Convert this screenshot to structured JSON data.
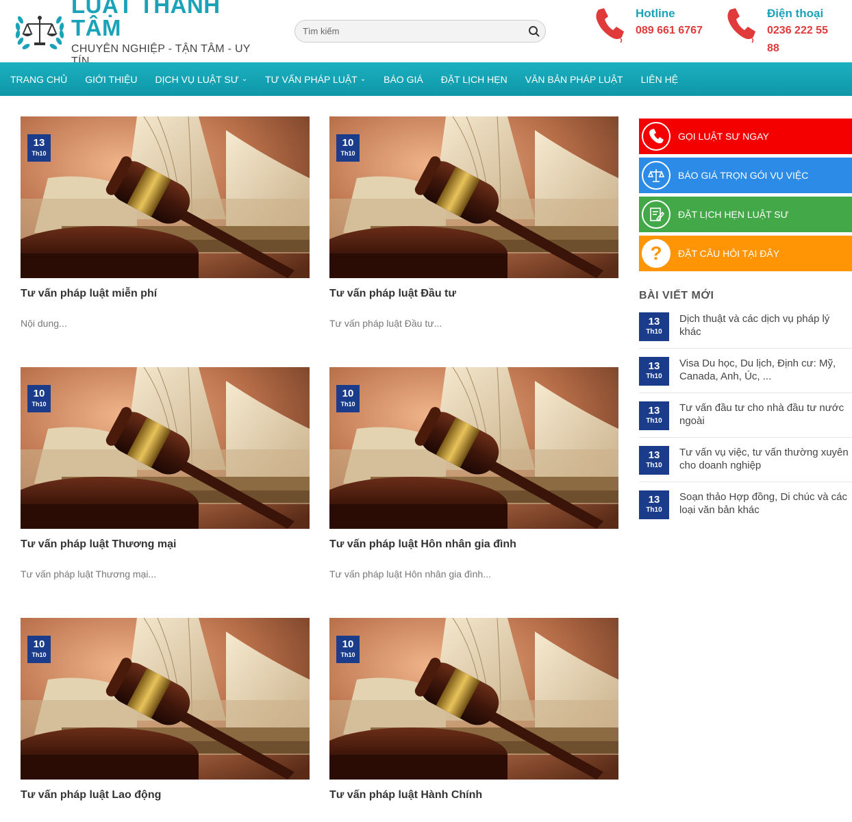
{
  "logo": {
    "title": "LUẬT THANH TÂM",
    "subtitle": "CHUYÊN NGHIỆP - TẬN TÂM - UY TÍN"
  },
  "search": {
    "placeholder": "Tìm kiếm"
  },
  "contacts": [
    {
      "label": "Hotline",
      "value": "089 661 6767"
    },
    {
      "label": "Điện thoại",
      "value_line1": "0236 222 55",
      "value_line2": "88"
    }
  ],
  "nav": [
    {
      "label": "TRANG CHỦ"
    },
    {
      "label": "GIỚI THIỆU"
    },
    {
      "label": "DỊCH VỤ LUẬT SƯ",
      "dropdown": true
    },
    {
      "label": "TƯ VẤN PHÁP LUẬT",
      "dropdown": true
    },
    {
      "label": "BÁO GIÁ"
    },
    {
      "label": "ĐẶT LỊCH HẸN"
    },
    {
      "label": "VĂN BẢN PHÁP LUẬT"
    },
    {
      "label": "LIÊN HỆ"
    }
  ],
  "posts": [
    {
      "day": "13",
      "month": "Th10",
      "title": "Tư vấn pháp luật miễn phí",
      "excerpt": "Nội dung..."
    },
    {
      "day": "10",
      "month": "Th10",
      "title": "Tư vấn pháp luật Đầu tư",
      "excerpt": "Tư vấn pháp luật Đầu tư..."
    },
    {
      "day": "10",
      "month": "Th10",
      "title": "Tư vấn pháp luật Thương mại",
      "excerpt": "Tư vấn pháp luật Thương mại..."
    },
    {
      "day": "10",
      "month": "Th10",
      "title": "Tư vấn pháp luật Hôn nhân gia đình",
      "excerpt": "Tư vấn pháp luật Hôn nhân gia đình..."
    },
    {
      "day": "10",
      "month": "Th10",
      "title": "Tư vấn pháp luật Lao động",
      "excerpt": ""
    },
    {
      "day": "10",
      "month": "Th10",
      "title": "Tư vấn pháp luật Hành Chính",
      "excerpt": ""
    }
  ],
  "sidebar": {
    "ctas": [
      {
        "label": "GỌI LUẬT SƯ NGAY",
        "color": "#f40000",
        "icon": "phone-icon"
      },
      {
        "label": "BÁO GIÁ TRỌN GÓI VỤ VIỆC",
        "color": "#2c8be6",
        "icon": "scales-icon"
      },
      {
        "label": "ĐẶT LỊCH HẸN LUẬT SƯ",
        "color": "#43a948",
        "icon": "edit-document-icon"
      },
      {
        "label": "ĐẶT CÂU HỎI TẠI ĐÂY",
        "color": "#ff9405",
        "icon": "question-icon"
      }
    ],
    "recent_heading": "BÀI VIẾT MỚI",
    "recent": [
      {
        "day": "13",
        "month": "Th10",
        "title": "Dịch thuật và các dịch vụ pháp lý khác"
      },
      {
        "day": "13",
        "month": "Th10",
        "title": "Visa Du học, Du lịch, Định cư: Mỹ, Canada, Anh, Úc, ..."
      },
      {
        "day": "13",
        "month": "Th10",
        "title": "Tư vấn đầu tư cho nhà đầu tư nước ngoài"
      },
      {
        "day": "13",
        "month": "Th10",
        "title": "Tư vấn vụ việc, tư vấn thường xuyên cho doanh nghiệp"
      },
      {
        "day": "13",
        "month": "Th10",
        "title": "Soạn thảo Hợp đồng, Di chúc và các loại văn bản khác"
      }
    ]
  },
  "colors": {
    "brand": "#1aa3b8",
    "nav": "#14a3b4",
    "badge": "#1b3c8a",
    "phone": "#e03a3a"
  }
}
